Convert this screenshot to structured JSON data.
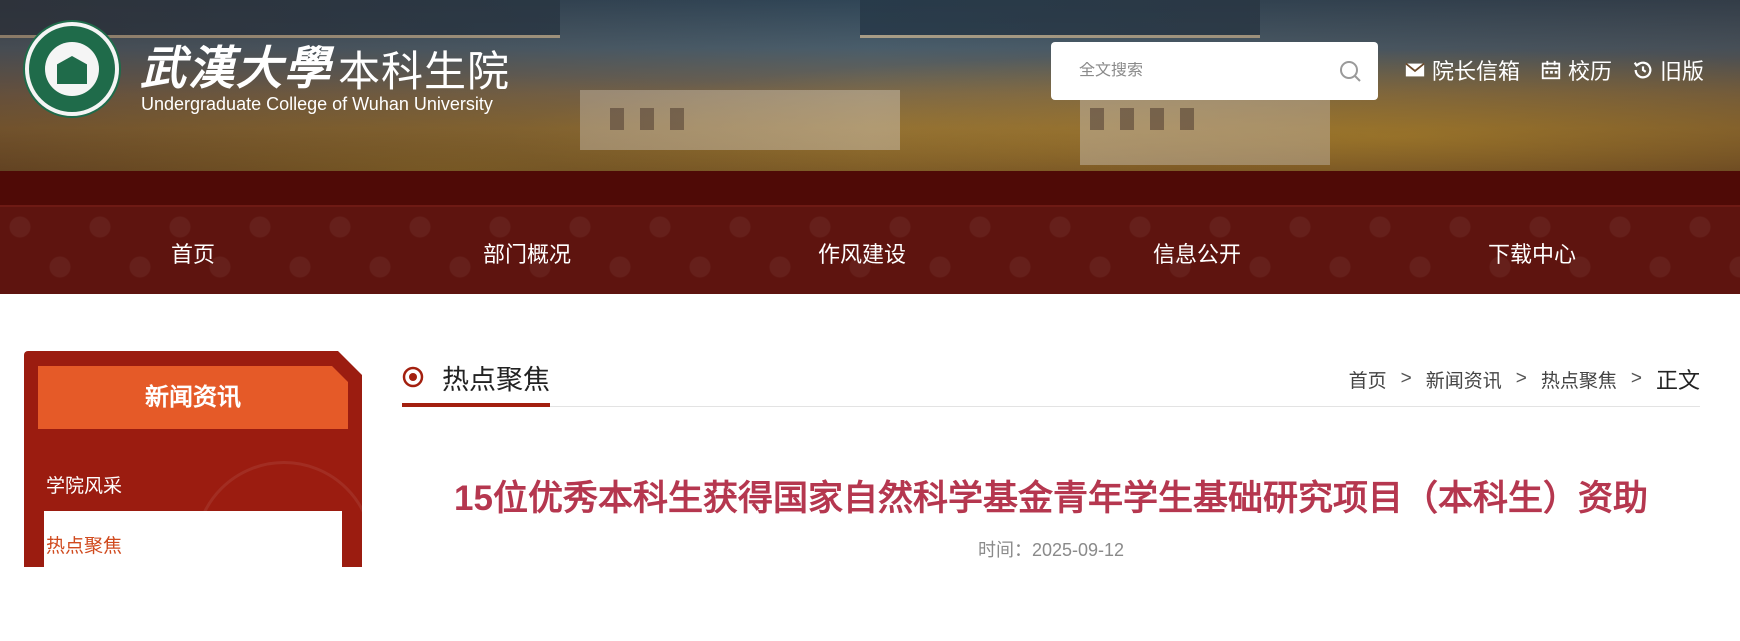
{
  "header": {
    "logo_cn": "武漢大學",
    "logo_cn_sub": "本科生院",
    "logo_en": "Undergraduate College of Wuhan University",
    "search_placeholder": "全文搜索",
    "links": [
      {
        "label": "院长信箱",
        "icon": "mail-icon"
      },
      {
        "label": "校历",
        "icon": "calendar-icon"
      },
      {
        "label": "旧版",
        "icon": "history-icon"
      }
    ]
  },
  "nav": {
    "items": [
      "首页",
      "部门概况",
      "作风建设",
      "信息公开",
      "下载中心"
    ]
  },
  "sidebar": {
    "title": "新闻资讯",
    "items": [
      "学院风采",
      "热点聚焦"
    ],
    "active_index": 1
  },
  "section": {
    "title": "热点聚焦",
    "breadcrumb": [
      "首页",
      "新闻资讯",
      "热点聚焦",
      "正文"
    ],
    "separator": ">"
  },
  "article": {
    "title": "15位优秀本科生获得国家自然科学基金青年学生基础研究项目（本科生）资助",
    "meta": "时间：2025-09-12"
  },
  "colors": {
    "nav_bg": "#5e140f",
    "sidebar_bg": "#9b1c10",
    "sidebar_title_bg": "#e55a28",
    "accent": "#a3200f",
    "article_title": "#b5374f"
  }
}
